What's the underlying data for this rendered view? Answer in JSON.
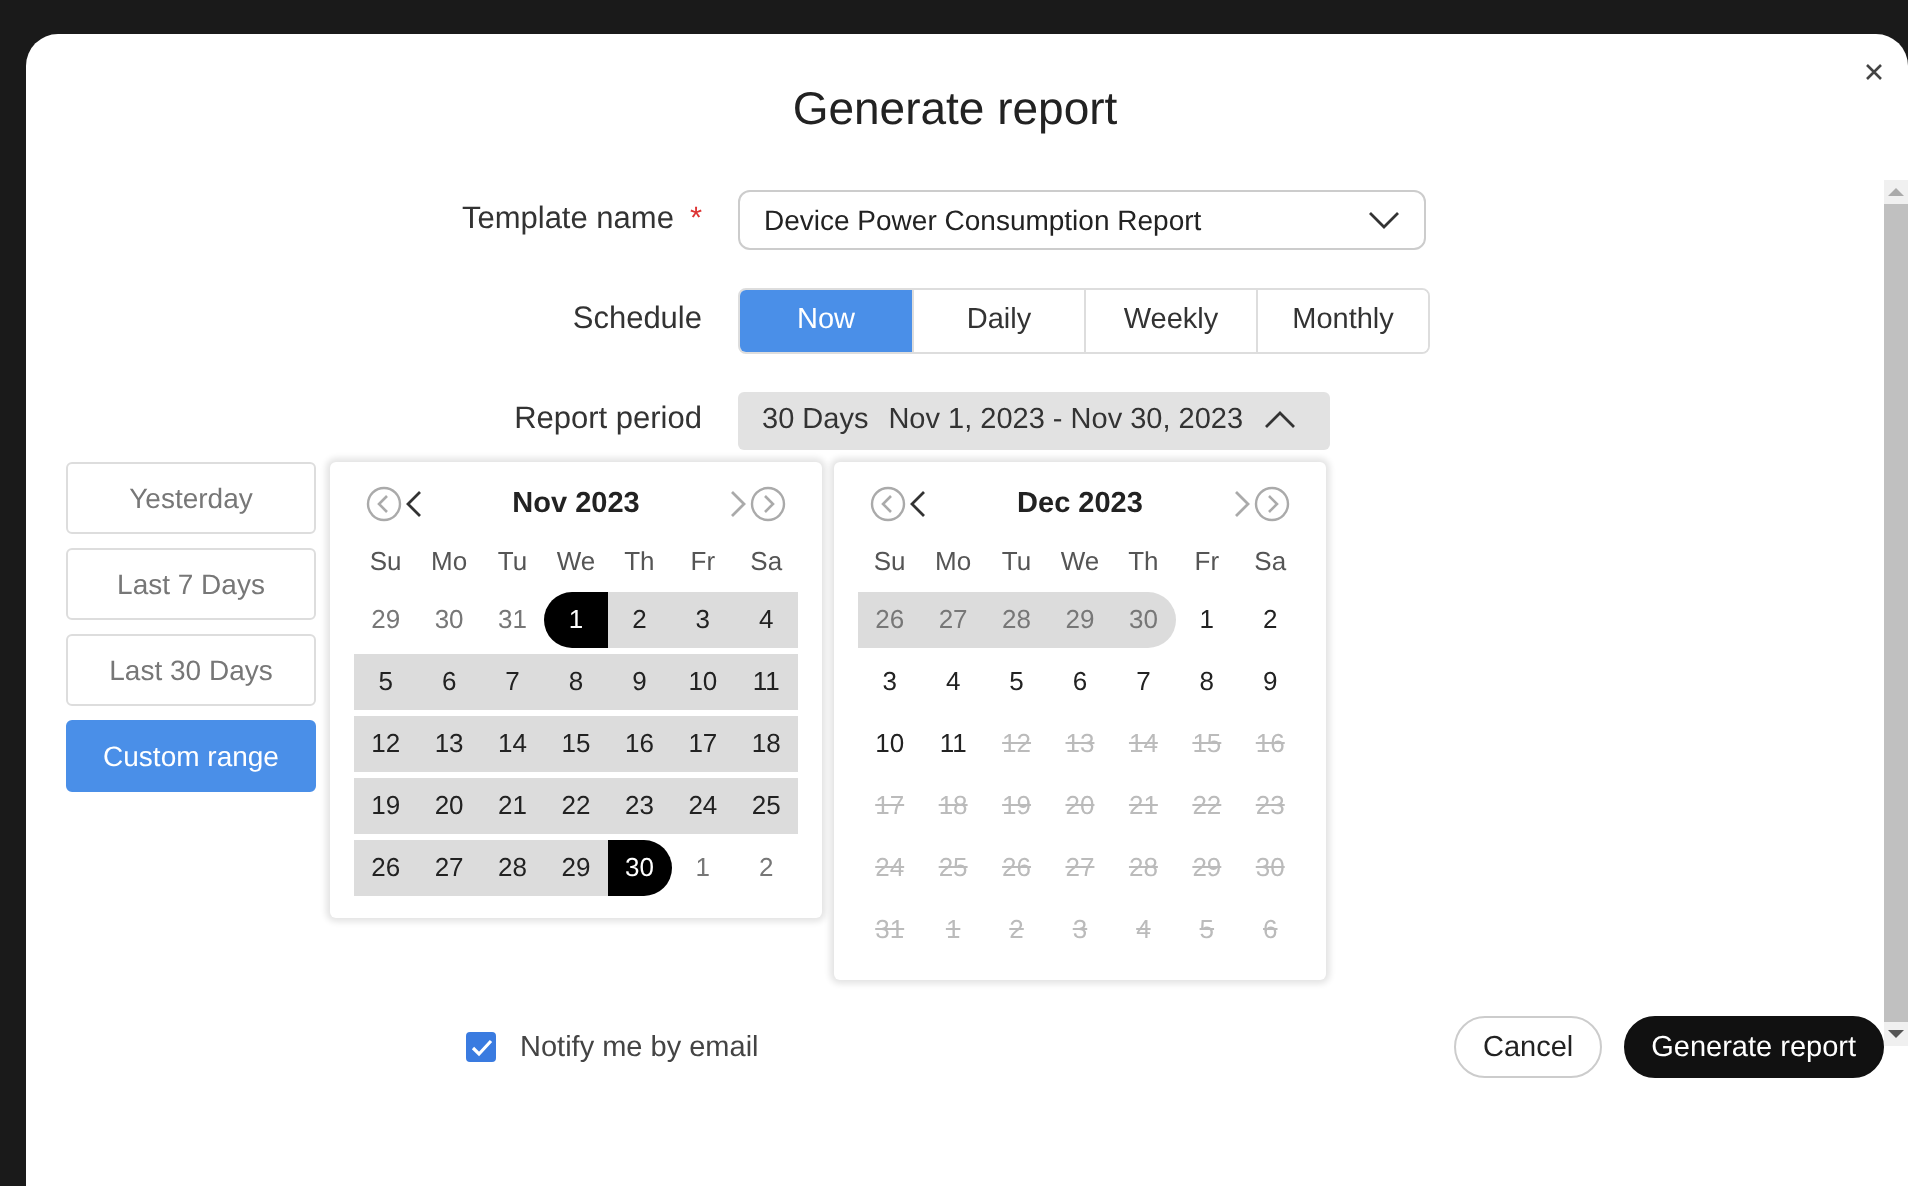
{
  "title": "Generate report",
  "form": {
    "template": {
      "label": "Template name",
      "required_mark": "*",
      "value": "Device Power Consumption Report"
    },
    "schedule": {
      "label": "Schedule",
      "options": [
        {
          "label": "Now",
          "selected": true
        },
        {
          "label": "Daily",
          "selected": false
        },
        {
          "label": "Weekly",
          "selected": false
        },
        {
          "label": "Monthly",
          "selected": false
        }
      ]
    },
    "period": {
      "label": "Report period",
      "days": "30 Days",
      "range": "Nov 1, 2023 - Nov 30, 2023",
      "expanded": true
    }
  },
  "presets": [
    {
      "label": "Yesterday",
      "selected": false
    },
    {
      "label": "Last 7 Days",
      "selected": false
    },
    {
      "label": "Last 30 Days",
      "selected": false
    },
    {
      "label": "Custom range",
      "selected": true
    }
  ],
  "calendars": [
    {
      "month": "Nov 2023",
      "weekdays": [
        "Su",
        "Mo",
        "Tu",
        "We",
        "Th",
        "Fr",
        "Sa"
      ],
      "weeks": [
        [
          {
            "day": "29",
            "kind": "other",
            "in_range": false,
            "selected": false
          },
          {
            "day": "30",
            "kind": "other",
            "in_range": false,
            "selected": false
          },
          {
            "day": "31",
            "kind": "other",
            "in_range": false,
            "selected": false
          },
          {
            "day": "1",
            "kind": "plain",
            "in_range": false,
            "selected": true
          },
          {
            "day": "2",
            "kind": "plain",
            "in_range": true,
            "selected": false
          },
          {
            "day": "3",
            "kind": "plain",
            "in_range": true,
            "selected": false
          },
          {
            "day": "4",
            "kind": "plain",
            "in_range": true,
            "selected": false
          }
        ],
        [
          {
            "day": "5",
            "kind": "plain",
            "in_range": true,
            "selected": false
          },
          {
            "day": "6",
            "kind": "plain",
            "in_range": true,
            "selected": false
          },
          {
            "day": "7",
            "kind": "plain",
            "in_range": true,
            "selected": false
          },
          {
            "day": "8",
            "kind": "plain",
            "in_range": true,
            "selected": false
          },
          {
            "day": "9",
            "kind": "plain",
            "in_range": true,
            "selected": false
          },
          {
            "day": "10",
            "kind": "plain",
            "in_range": true,
            "selected": false
          },
          {
            "day": "11",
            "kind": "plain",
            "in_range": true,
            "selected": false
          }
        ],
        [
          {
            "day": "12",
            "kind": "plain",
            "in_range": true,
            "selected": false
          },
          {
            "day": "13",
            "kind": "plain",
            "in_range": true,
            "selected": false
          },
          {
            "day": "14",
            "kind": "plain",
            "in_range": true,
            "selected": false
          },
          {
            "day": "15",
            "kind": "plain",
            "in_range": true,
            "selected": false
          },
          {
            "day": "16",
            "kind": "plain",
            "in_range": true,
            "selected": false
          },
          {
            "day": "17",
            "kind": "plain",
            "in_range": true,
            "selected": false
          },
          {
            "day": "18",
            "kind": "plain",
            "in_range": true,
            "selected": false
          }
        ],
        [
          {
            "day": "19",
            "kind": "plain",
            "in_range": true,
            "selected": false
          },
          {
            "day": "20",
            "kind": "plain",
            "in_range": true,
            "selected": false
          },
          {
            "day": "21",
            "kind": "plain",
            "in_range": true,
            "selected": false
          },
          {
            "day": "22",
            "kind": "plain",
            "in_range": true,
            "selected": false
          },
          {
            "day": "23",
            "kind": "plain",
            "in_range": true,
            "selected": false
          },
          {
            "day": "24",
            "kind": "plain",
            "in_range": true,
            "selected": false
          },
          {
            "day": "25",
            "kind": "plain",
            "in_range": true,
            "selected": false
          }
        ],
        [
          {
            "day": "26",
            "kind": "plain",
            "in_range": true,
            "selected": false
          },
          {
            "day": "27",
            "kind": "plain",
            "in_range": true,
            "selected": false
          },
          {
            "day": "28",
            "kind": "plain",
            "in_range": true,
            "selected": false
          },
          {
            "day": "29",
            "kind": "plain",
            "in_range": true,
            "selected": false
          },
          {
            "day": "30",
            "kind": "plain",
            "in_range": false,
            "selected": true
          },
          {
            "day": "1",
            "kind": "other",
            "in_range": false,
            "selected": false
          },
          {
            "day": "2",
            "kind": "other",
            "in_range": false,
            "selected": false
          }
        ]
      ]
    },
    {
      "month": "Dec 2023",
      "weekdays": [
        "Su",
        "Mo",
        "Tu",
        "We",
        "Th",
        "Fr",
        "Sa"
      ],
      "weeks": [
        [
          {
            "day": "26",
            "kind": "other",
            "in_range": true,
            "selected": false
          },
          {
            "day": "27",
            "kind": "other",
            "in_range": true,
            "selected": false
          },
          {
            "day": "28",
            "kind": "other",
            "in_range": true,
            "selected": false
          },
          {
            "day": "29",
            "kind": "other",
            "in_range": true,
            "selected": false
          },
          {
            "day": "30",
            "kind": "other",
            "in_range": true,
            "selected": false
          },
          {
            "day": "1",
            "kind": "plain",
            "in_range": false,
            "selected": false
          },
          {
            "day": "2",
            "kind": "plain",
            "in_range": false,
            "selected": false
          }
        ],
        [
          {
            "day": "3",
            "kind": "plain",
            "in_range": false,
            "selected": false
          },
          {
            "day": "4",
            "kind": "plain",
            "in_range": false,
            "selected": false
          },
          {
            "day": "5",
            "kind": "plain",
            "in_range": false,
            "selected": false
          },
          {
            "day": "6",
            "kind": "plain",
            "in_range": false,
            "selected": false
          },
          {
            "day": "7",
            "kind": "plain",
            "in_range": false,
            "selected": false
          },
          {
            "day": "8",
            "kind": "plain",
            "in_range": false,
            "selected": false
          },
          {
            "day": "9",
            "kind": "plain",
            "in_range": false,
            "selected": false
          }
        ],
        [
          {
            "day": "10",
            "kind": "plain",
            "in_range": false,
            "selected": false
          },
          {
            "day": "11",
            "kind": "plain",
            "in_range": false,
            "selected": false
          },
          {
            "day": "12",
            "kind": "disabled",
            "in_range": false,
            "selected": false
          },
          {
            "day": "13",
            "kind": "disabled",
            "in_range": false,
            "selected": false
          },
          {
            "day": "14",
            "kind": "disabled",
            "in_range": false,
            "selected": false
          },
          {
            "day": "15",
            "kind": "disabled",
            "in_range": false,
            "selected": false
          },
          {
            "day": "16",
            "kind": "disabled",
            "in_range": false,
            "selected": false
          }
        ],
        [
          {
            "day": "17",
            "kind": "disabled",
            "in_range": false,
            "selected": false
          },
          {
            "day": "18",
            "kind": "disabled",
            "in_range": false,
            "selected": false
          },
          {
            "day": "19",
            "kind": "disabled",
            "in_range": false,
            "selected": false
          },
          {
            "day": "20",
            "kind": "disabled",
            "in_range": false,
            "selected": false
          },
          {
            "day": "21",
            "kind": "disabled",
            "in_range": false,
            "selected": false
          },
          {
            "day": "22",
            "kind": "disabled",
            "in_range": false,
            "selected": false
          },
          {
            "day": "23",
            "kind": "disabled",
            "in_range": false,
            "selected": false
          }
        ],
        [
          {
            "day": "24",
            "kind": "disabled",
            "in_range": false,
            "selected": false
          },
          {
            "day": "25",
            "kind": "disabled",
            "in_range": false,
            "selected": false
          },
          {
            "day": "26",
            "kind": "disabled",
            "in_range": false,
            "selected": false
          },
          {
            "day": "27",
            "kind": "disabled",
            "in_range": false,
            "selected": false
          },
          {
            "day": "28",
            "kind": "disabled",
            "in_range": false,
            "selected": false
          },
          {
            "day": "29",
            "kind": "disabled",
            "in_range": false,
            "selected": false
          },
          {
            "day": "30",
            "kind": "disabled",
            "in_range": false,
            "selected": false
          }
        ],
        [
          {
            "day": "31",
            "kind": "disabled",
            "in_range": false,
            "selected": false
          },
          {
            "day": "1",
            "kind": "disabled",
            "in_range": false,
            "selected": false
          },
          {
            "day": "2",
            "kind": "disabled",
            "in_range": false,
            "selected": false
          },
          {
            "day": "3",
            "kind": "disabled",
            "in_range": false,
            "selected": false
          },
          {
            "day": "4",
            "kind": "disabled",
            "in_range": false,
            "selected": false
          },
          {
            "day": "5",
            "kind": "disabled",
            "in_range": false,
            "selected": false
          },
          {
            "day": "6",
            "kind": "disabled",
            "in_range": false,
            "selected": false
          }
        ]
      ]
    }
  ],
  "notify": {
    "label": "Notify me by email",
    "checked": true
  },
  "buttons": [
    {
      "label": "Cancel",
      "kind": "secondary"
    },
    {
      "label": "Generate report",
      "kind": "primary"
    }
  ]
}
